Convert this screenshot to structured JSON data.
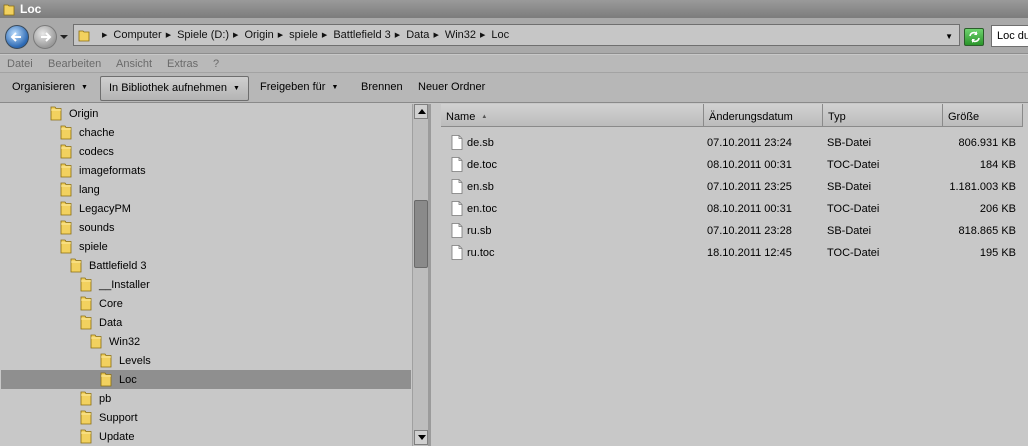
{
  "window": {
    "title": "Loc"
  },
  "address": {
    "crumbs": [
      "Computer",
      "Spiele (D:)",
      "Origin",
      "spiele",
      "Battlefield 3",
      "Data",
      "Win32",
      "Loc"
    ],
    "search_value": "Loc du"
  },
  "menu": {
    "items": [
      "Datei",
      "Bearbeiten",
      "Ansicht",
      "Extras",
      "?"
    ]
  },
  "commands": {
    "organize": "Organisieren",
    "library": "In Bibliothek aufnehmen",
    "share": "Freigeben für",
    "burn": "Brennen",
    "new_folder": "Neuer Ordner"
  },
  "tree": [
    {
      "label": "Origin",
      "level": 0
    },
    {
      "label": "chache",
      "level": 1
    },
    {
      "label": "codecs",
      "level": 1
    },
    {
      "label": "imageformats",
      "level": 1
    },
    {
      "label": "lang",
      "level": 1
    },
    {
      "label": "LegacyPM",
      "level": 1
    },
    {
      "label": "sounds",
      "level": 1
    },
    {
      "label": "spiele",
      "level": 1
    },
    {
      "label": "Battlefield 3",
      "level": 2
    },
    {
      "label": "__Installer",
      "level": 3
    },
    {
      "label": "Core",
      "level": 3
    },
    {
      "label": "Data",
      "level": 3
    },
    {
      "label": "Win32",
      "level": 4
    },
    {
      "label": "Levels",
      "level": 5
    },
    {
      "label": "Loc",
      "level": 5,
      "selected": true
    },
    {
      "label": "pb",
      "level": 3
    },
    {
      "label": "Support",
      "level": 3
    },
    {
      "label": "Update",
      "level": 3
    }
  ],
  "columns": {
    "name": "Name",
    "date": "Änderungsdatum",
    "type": "Typ",
    "size": "Größe"
  },
  "files": [
    {
      "name": "de.sb",
      "date": "07.10.2011 23:24",
      "type": "SB-Datei",
      "size": "806.931 KB"
    },
    {
      "name": "de.toc",
      "date": "08.10.2011 00:31",
      "type": "TOC-Datei",
      "size": "184 KB"
    },
    {
      "name": "en.sb",
      "date": "07.10.2011 23:25",
      "type": "SB-Datei",
      "size": "1.181.003 KB"
    },
    {
      "name": "en.toc",
      "date": "08.10.2011 00:31",
      "type": "TOC-Datei",
      "size": "206 KB"
    },
    {
      "name": "ru.sb",
      "date": "07.10.2011 23:28",
      "type": "SB-Datei",
      "size": "818.865 KB"
    },
    {
      "name": "ru.toc",
      "date": "18.10.2011 12:45",
      "type": "TOC-Datei",
      "size": "195 KB"
    }
  ],
  "colors": {
    "folder": "#f2d15f",
    "selection": "#8f8f8f",
    "back_button": "#2b68b3",
    "refresh": "#2a952a"
  },
  "icons": [
    "folder-icon",
    "document-icon",
    "back-arrow-icon",
    "forward-arrow-icon",
    "refresh-icon"
  ]
}
